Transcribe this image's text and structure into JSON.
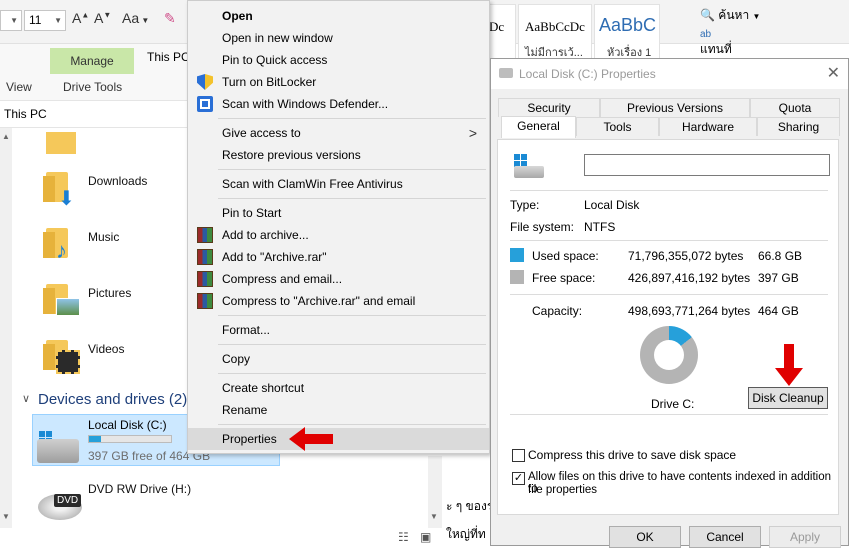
{
  "colors": {
    "accent": "#26a0da",
    "used_space": "#26a0da",
    "free_space": "#b4b4b4",
    "manage_tab": "#c9e7a8",
    "selection": "#cce8ff",
    "annotation_arrow": "#e00000"
  },
  "word_ribbon": {
    "font_size": "11",
    "font_color_icon": "A",
    "change_case": "Aa",
    "style_samples": [
      "Dc",
      "AaBbCcDc",
      "AaBbC"
    ],
    "style_names": [
      "ไม่มีการเว้...",
      "หัวเรื่อง 1"
    ],
    "find_label": "ค้นหา",
    "replace_label": "แทนที่"
  },
  "explorer": {
    "ribbon_tabs": {
      "manage": "Manage",
      "view": "View",
      "drive_tools": "Drive Tools",
      "this_pc_title": "This PC"
    },
    "address": "This PC",
    "folders": [
      {
        "name": "Downloads"
      },
      {
        "name": "Music"
      },
      {
        "name": "Pictures"
      },
      {
        "name": "Videos"
      }
    ],
    "devices_header": "Devices and drives (2)",
    "drives": [
      {
        "name": "Local Disk (C:)",
        "detail": "397 GB free of 464 GB",
        "used_fraction": 0.144
      },
      {
        "name": "DVD RW Drive (H:)",
        "badge": "DVD"
      }
    ]
  },
  "context_menu": {
    "items": [
      {
        "label": "Open"
      },
      {
        "label": "Open in new window"
      },
      {
        "label": "Pin to Quick access"
      },
      {
        "label": "Turn on BitLocker"
      },
      {
        "label": "Scan with Windows Defender..."
      },
      {
        "label": "Give access to"
      },
      {
        "label": "Restore previous versions"
      },
      {
        "label": "Scan with ClamWin Free Antivirus"
      },
      {
        "label": "Pin to Start"
      },
      {
        "label": "Add to archive..."
      },
      {
        "label": "Add to \"Archive.rar\""
      },
      {
        "label": "Compress and email..."
      },
      {
        "label": "Compress to \"Archive.rar\" and email"
      },
      {
        "label": "Format..."
      },
      {
        "label": "Copy"
      },
      {
        "label": "Create shortcut"
      },
      {
        "label": "Rename"
      },
      {
        "label": "Properties"
      }
    ]
  },
  "properties_dialog": {
    "title": "Local Disk (C:) Properties",
    "tabs_row1": [
      "Security",
      "Previous Versions",
      "Quota"
    ],
    "tabs_row2": [
      "General",
      "Tools",
      "Hardware",
      "Sharing"
    ],
    "active_tab": "General",
    "volume_label_value": "",
    "type_label": "Type:",
    "type_value": "Local Disk",
    "fs_label": "File system:",
    "fs_value": "NTFS",
    "used_label": "Used space:",
    "used_bytes": "71,796,355,072 bytes",
    "used_size": "66.8 GB",
    "free_label": "Free space:",
    "free_bytes": "426,897,416,192 bytes",
    "free_size": "397 GB",
    "capacity_label": "Capacity:",
    "capacity_bytes": "498,693,771,264 bytes",
    "capacity_size": "464 GB",
    "used_fraction": 0.144,
    "drive_label": "Drive C:",
    "disk_cleanup": "Disk Cleanup",
    "compress_label": "Compress this drive to save disk space",
    "compress_checked": false,
    "index_label_line1": "Allow files on this drive to have contents indexed in addition to",
    "index_label_line2": "file properties",
    "index_checked": true,
    "ok": "OK",
    "cancel": "Cancel",
    "apply": "Apply"
  },
  "doc_background": {
    "text_line1": "ะ ๆ ของระ",
    "text_line2": "ใหญ่ที่ท"
  }
}
